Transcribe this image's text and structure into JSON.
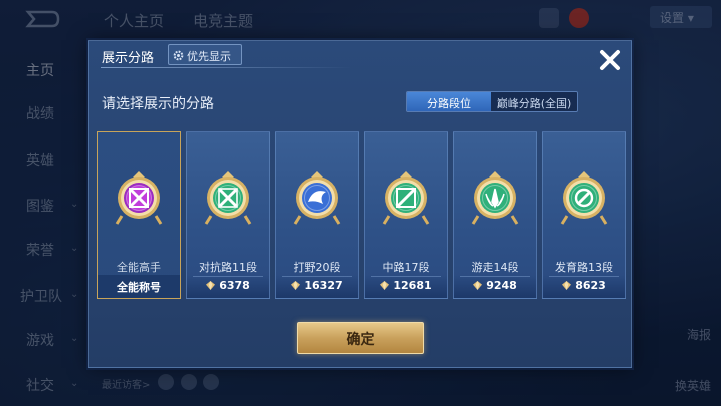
{
  "header": {
    "tabs": [
      "个人主页",
      "电竞主题"
    ],
    "settings_label": "设置"
  },
  "sidebar": {
    "items": [
      "主页",
      "战绩",
      "英雄",
      "图鉴",
      "荣誉",
      "护卫队",
      "游戏",
      "社交"
    ]
  },
  "bottom": {
    "recent_visitors": "最近访客>"
  },
  "right": {
    "poster": "海报",
    "hero": "换英雄"
  },
  "dialog": {
    "title": "展示分路",
    "priority_button": "优先显示",
    "prompt": "请选择展示的分路",
    "segments": [
      {
        "label": "分路段位",
        "active": true
      },
      {
        "label": "巅峰分路(全国)",
        "active": false
      }
    ],
    "cards": [
      {
        "name": "全能高手",
        "footer": "全能称号",
        "selected": true,
        "icon": "all-round-emblem-icon",
        "color": "#b83ad0"
      },
      {
        "name": "对抗路11段",
        "score": "6378",
        "selected": false,
        "icon": "clash-lane-emblem-icon",
        "color": "#2fb07a"
      },
      {
        "name": "打野20段",
        "score": "16327",
        "selected": false,
        "icon": "jungle-emblem-icon",
        "color": "#3a6fd6"
      },
      {
        "name": "中路17段",
        "score": "12681",
        "selected": false,
        "icon": "mid-lane-emblem-icon",
        "color": "#2fb07a"
      },
      {
        "name": "游走14段",
        "score": "9248",
        "selected": false,
        "icon": "roam-emblem-icon",
        "color": "#2fb07a"
      },
      {
        "name": "发育路13段",
        "score": "8623",
        "selected": false,
        "icon": "farm-lane-emblem-icon",
        "color": "#2fb07a"
      }
    ],
    "confirm_label": "确定"
  },
  "colors": {
    "gold": "#c9a15c",
    "accent_blue": "#3d7ad0"
  }
}
